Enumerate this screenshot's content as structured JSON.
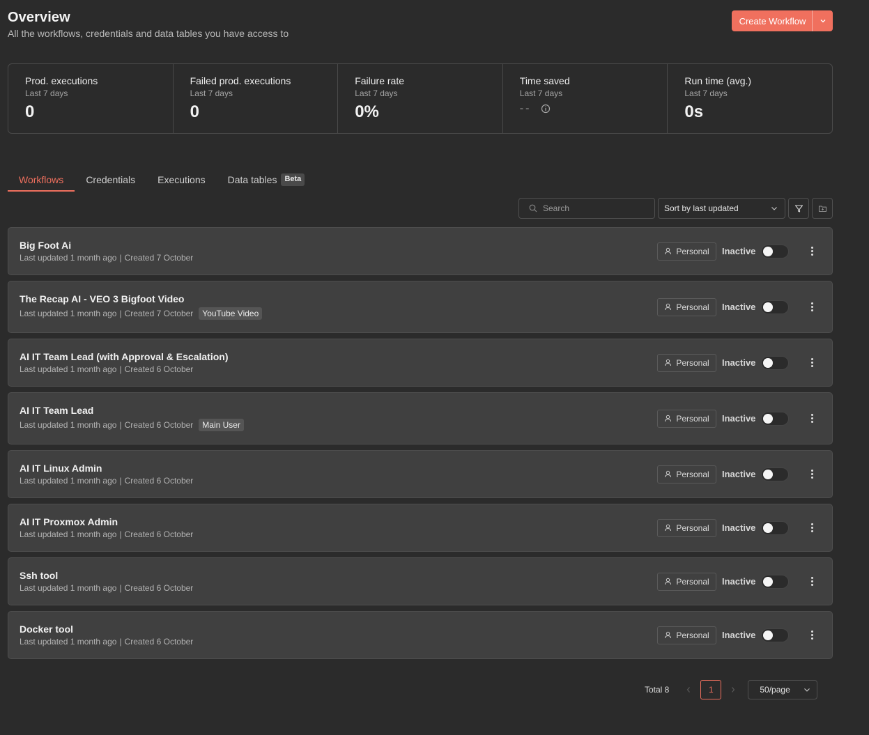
{
  "header": {
    "title": "Overview",
    "subtitle": "All the workflows, credentials and data tables you have access to",
    "create_label": "Create Workflow"
  },
  "stats": [
    {
      "title": "Prod. executions",
      "period": "Last 7 days",
      "value": "0"
    },
    {
      "title": "Failed prod. executions",
      "period": "Last 7 days",
      "value": "0"
    },
    {
      "title": "Failure rate",
      "period": "Last 7 days",
      "value": "0%"
    },
    {
      "title": "Time saved",
      "period": "Last 7 days",
      "value": "--"
    },
    {
      "title": "Run time (avg.)",
      "period": "Last 7 days",
      "value": "0s"
    }
  ],
  "tabs": {
    "workflows": "Workflows",
    "credentials": "Credentials",
    "executions": "Executions",
    "data_tables": "Data tables",
    "beta": "Beta"
  },
  "toolbar": {
    "search_placeholder": "Search",
    "sort_label": "Sort by last updated"
  },
  "workflows": [
    {
      "name": "Big Foot Ai",
      "updated": "Last updated 1 month ago",
      "created": "Created 7 October",
      "tag": "",
      "owner": "Personal",
      "status": "Inactive"
    },
    {
      "name": "The Recap AI - VEO 3 Bigfoot Video",
      "updated": "Last updated 1 month ago",
      "created": "Created 7 October",
      "tag": "YouTube Video",
      "owner": "Personal",
      "status": "Inactive"
    },
    {
      "name": "AI IT Team Lead (with Approval & Escalation)",
      "updated": "Last updated 1 month ago",
      "created": "Created 6 October",
      "tag": "",
      "owner": "Personal",
      "status": "Inactive"
    },
    {
      "name": "AI IT Team Lead",
      "updated": "Last updated 1 month ago",
      "created": "Created 6 October",
      "tag": "Main User",
      "owner": "Personal",
      "status": "Inactive"
    },
    {
      "name": "AI IT Linux Admin",
      "updated": "Last updated 1 month ago",
      "created": "Created 6 October",
      "tag": "",
      "owner": "Personal",
      "status": "Inactive"
    },
    {
      "name": "AI IT Proxmox Admin",
      "updated": "Last updated 1 month ago",
      "created": "Created 6 October",
      "tag": "",
      "owner": "Personal",
      "status": "Inactive"
    },
    {
      "name": "Ssh tool",
      "updated": "Last updated 1 month ago",
      "created": "Created 6 October",
      "tag": "",
      "owner": "Personal",
      "status": "Inactive"
    },
    {
      "name": "Docker tool",
      "updated": "Last updated 1 month ago",
      "created": "Created 6 October",
      "tag": "",
      "owner": "Personal",
      "status": "Inactive"
    }
  ],
  "pagination": {
    "total": "Total 8",
    "current_page": "1",
    "page_size": "50/page"
  },
  "colors": {
    "accent": "#f0705e",
    "background": "#2b2b2b",
    "card": "#404040"
  }
}
